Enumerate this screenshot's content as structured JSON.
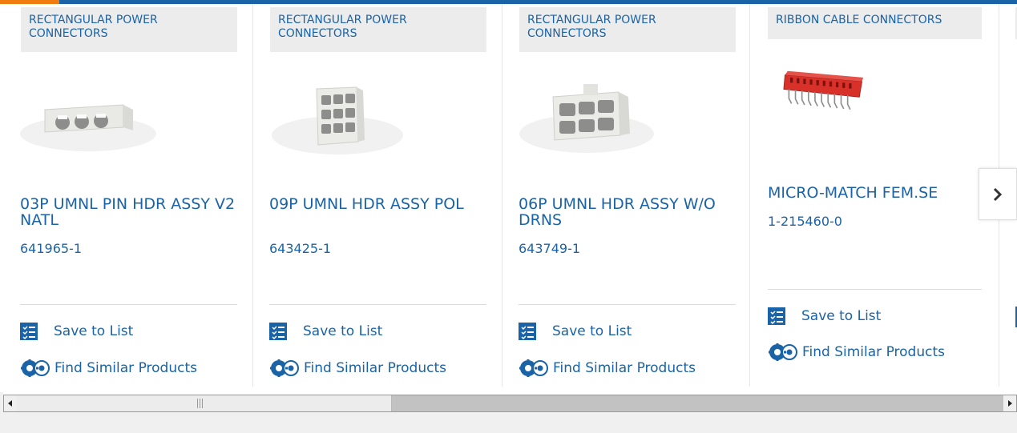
{
  "cards": [
    {
      "category": "RECTANGULAR POWER CONNECTORS",
      "title": "03P UMNL PIN HDR ASSY V2 NATL",
      "part_number": "641965-1",
      "save_label": "Save to List",
      "find_label": "Find Similar Products",
      "image_icon": "connector-3pin-image"
    },
    {
      "category": "RECTANGULAR POWER CONNECTORS",
      "title": "09P UMNL HDR ASSY POL",
      "part_number": "643425-1",
      "save_label": "Save to List",
      "find_label": "Find Similar Products",
      "image_icon": "connector-9pin-image"
    },
    {
      "category": "RECTANGULAR POWER CONNECTORS",
      "title": "06P UMNL HDR ASSY W/O DRNS",
      "part_number": "643749-1",
      "save_label": "Save to List",
      "find_label": "Find Similar Products",
      "image_icon": "connector-6pin-image"
    },
    {
      "category": "RIBBON CABLE CONNECTORS",
      "title": "MICRO-MATCH FEM.SE",
      "part_number": "1-215460-0",
      "save_label": "Save to List",
      "find_label": "Find Similar Products",
      "image_icon": "ribbon-connector-image"
    }
  ],
  "carousel": {
    "next_icon": "chevron-right-icon"
  },
  "colors": {
    "link": "#1a63a6",
    "accent": "#f07c0f",
    "badge_bg": "#ececec",
    "ribbon_red": "#d8312a"
  }
}
